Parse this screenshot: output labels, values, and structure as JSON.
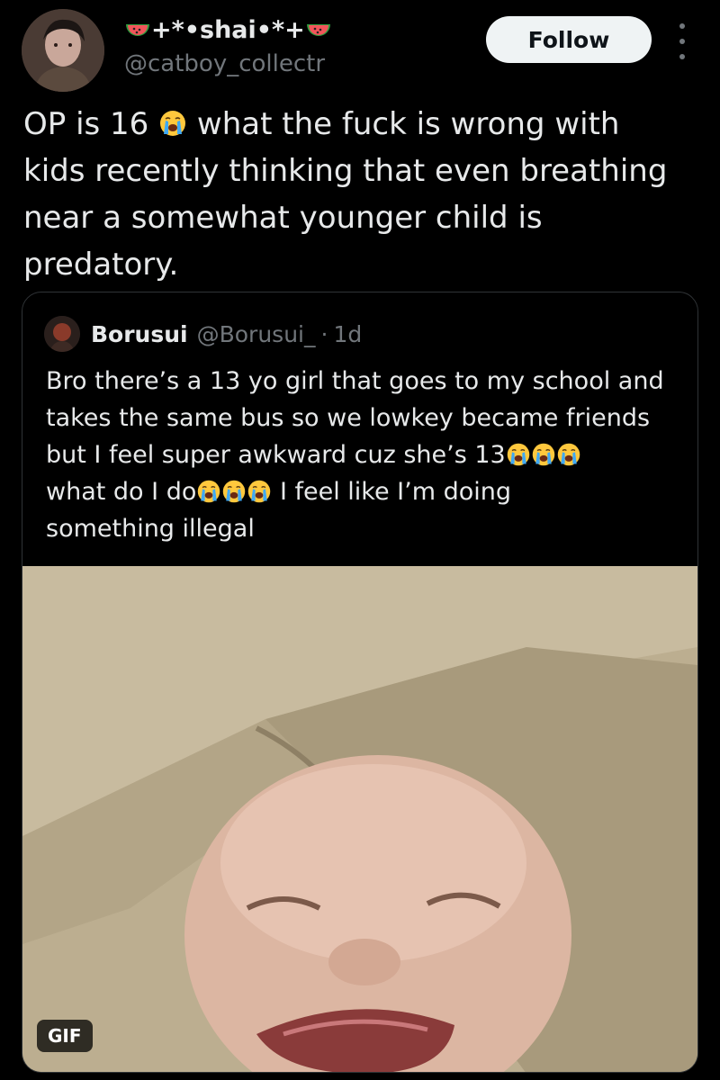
{
  "author": {
    "name_prefix": "+*•",
    "name_core": " shai ",
    "name_suffix": "•*+",
    "handle": "@catboy_collectr",
    "avatar_icon": "user-avatar"
  },
  "actions": {
    "follow_label": "Follow",
    "more_icon": "more-vertical-icon"
  },
  "tweet": {
    "line1_a": "OP is 16 ",
    "line1_b": " what the fuck is wrong with",
    "line2": "kids recently thinking that even breathing",
    "line3": "near a somewhat younger child is",
    "line4": "predatory."
  },
  "quote": {
    "author_name": "Borusui",
    "author_handle": "@Borusui_",
    "separator": "·",
    "time": "1d",
    "line1": "Bro there’s a 13 yo girl that goes to my school and",
    "line2": "takes the same bus so we lowkey became friends",
    "line3": "but I feel super awkward cuz she’s 13",
    "line4_a": "what do I do",
    "line4_b": " I feel like I’m doing",
    "line5": "something illegal",
    "media_badge": "GIF"
  },
  "colors": {
    "background": "#000000",
    "text_primary": "#e7e9ea",
    "text_secondary": "#71767b",
    "border": "#2f3336",
    "follow_bg": "#eff3f4",
    "follow_text": "#0f1419",
    "emoji_face": "#ffc83d",
    "emoji_tears": "#3fa9f5"
  }
}
